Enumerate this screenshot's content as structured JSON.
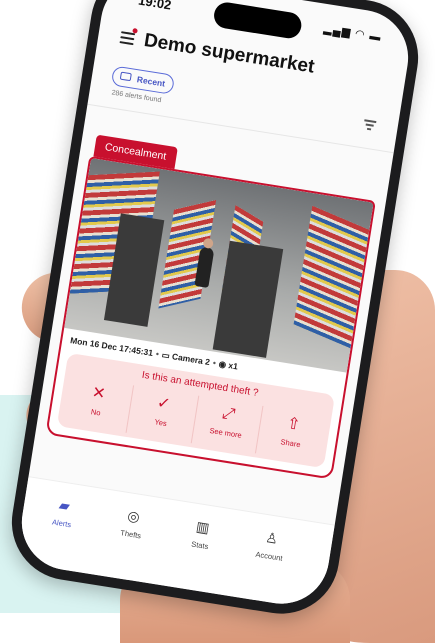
{
  "status_bar": {
    "time": "19:02",
    "icons": "▂▄▆ ◠ ▬"
  },
  "header": {
    "title": "Demo supermarket"
  },
  "filter": {
    "chip_label": "Recent",
    "result_count": "286 alerts found"
  },
  "alert": {
    "tag": "Concealment",
    "meta": {
      "datetime": "Mon 16 Dec 17:45:31",
      "camera": "Camera 2",
      "views": "x1"
    },
    "question": "Is this an attempted theft ?",
    "actions": [
      {
        "label": "No",
        "icon": "close-icon",
        "glyph": "✕"
      },
      {
        "label": "Yes",
        "icon": "check-icon",
        "glyph": "✓"
      },
      {
        "label": "See more",
        "icon": "expand-icon",
        "glyph": "⤢"
      },
      {
        "label": "Share",
        "icon": "share-icon",
        "glyph": "⇧"
      }
    ]
  },
  "nav": [
    {
      "label": "Alerts",
      "icon": "camera-icon",
      "glyph": "▰",
      "active": true
    },
    {
      "label": "Thefts",
      "icon": "thefts-icon",
      "glyph": "◎",
      "active": false
    },
    {
      "label": "Stats",
      "icon": "stats-icon",
      "glyph": "▥",
      "active": false
    },
    {
      "label": "Account",
      "icon": "account-icon",
      "glyph": "♙",
      "active": false
    }
  ],
  "colors": {
    "accent": "#c8102e",
    "nav_active": "#4756c4",
    "background_band": "#d9f3f1"
  }
}
